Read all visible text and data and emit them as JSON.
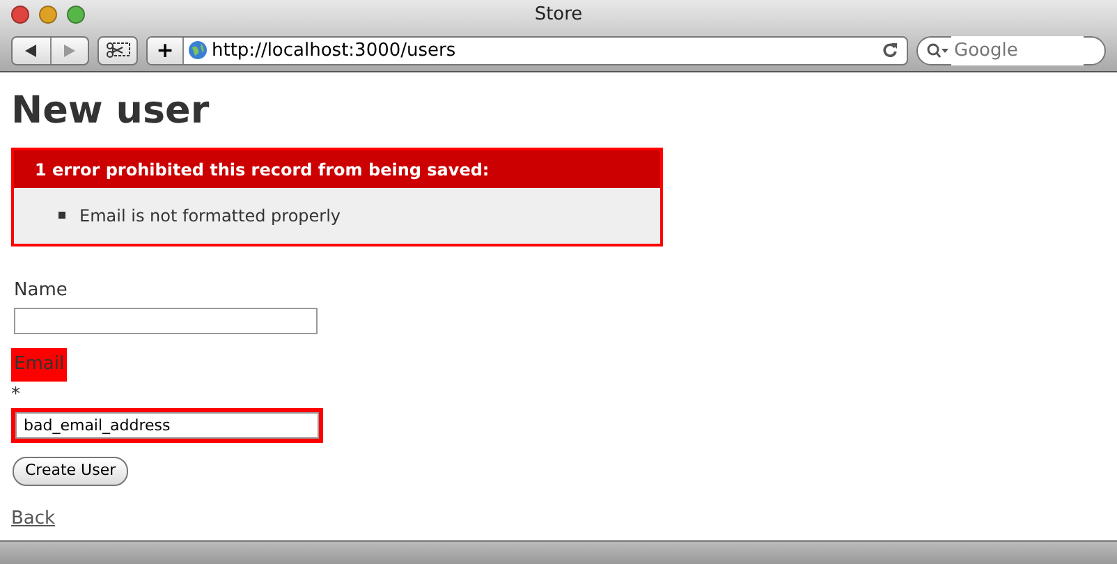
{
  "window": {
    "title": "Store"
  },
  "toolbar": {
    "bookmark_button": "+",
    "address": "http://localhost:3000/users",
    "search_placeholder": "Google"
  },
  "page": {
    "heading": "New user",
    "error_box": {
      "title": "1 error prohibited this record from being saved:",
      "messages": [
        "Email is not formatted properly"
      ]
    },
    "fields": [
      {
        "label": "Name",
        "error": false
      },
      {
        "label": "Email",
        "required_mark": "*",
        "value": "bad_email_address",
        "error": true
      }
    ],
    "submit": "Create User",
    "back_link": "Back"
  }
}
